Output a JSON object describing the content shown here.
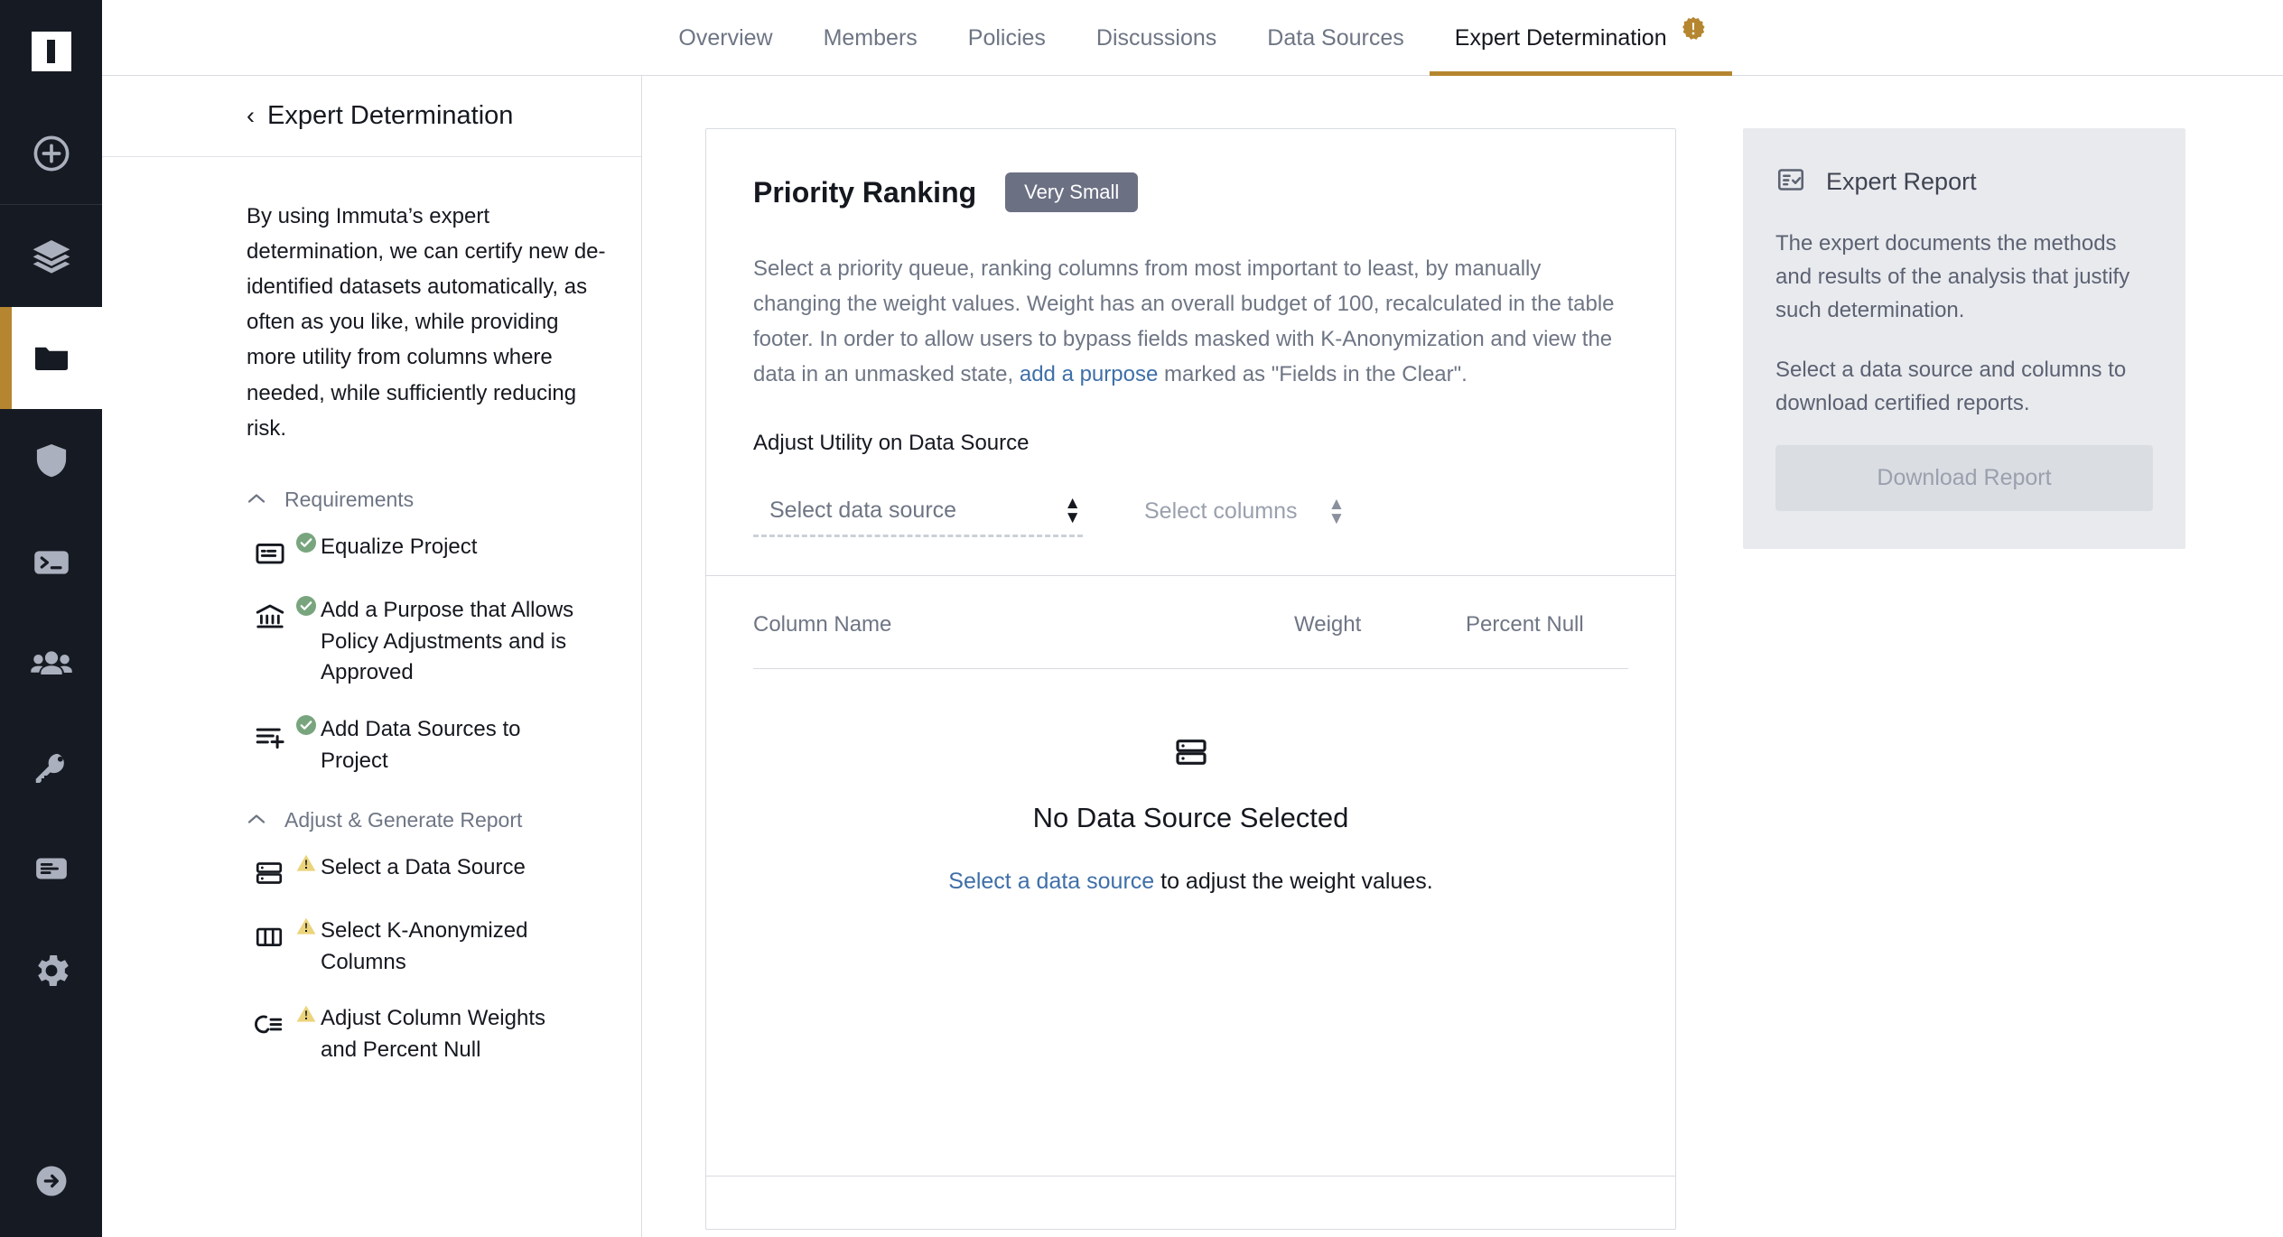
{
  "brand": {
    "logo_name": "immuta-logo",
    "accent_gold": "#B5862F",
    "rail_bg": "#161A22",
    "link_blue": "#3F6FA8",
    "badge_slate": "#6B7083"
  },
  "rail": {
    "items": [
      {
        "name": "add-icon",
        "label": "Add"
      },
      {
        "name": "layers-icon",
        "label": "Data"
      },
      {
        "name": "folder-icon",
        "label": "Projects",
        "active": true
      },
      {
        "name": "shield-icon",
        "label": "Governance"
      },
      {
        "name": "terminal-icon",
        "label": "Query"
      },
      {
        "name": "people-icon",
        "label": "People"
      },
      {
        "name": "key-icon",
        "label": "Identity"
      },
      {
        "name": "audit-icon",
        "label": "Audit"
      },
      {
        "name": "gear-icon",
        "label": "Settings"
      }
    ],
    "bottom": {
      "name": "collapse-arrow-icon",
      "label": "Expand"
    }
  },
  "tabs": [
    {
      "label": "Overview",
      "active": false,
      "badge": false
    },
    {
      "label": "Members",
      "active": false,
      "badge": false
    },
    {
      "label": "Policies",
      "active": false,
      "badge": false
    },
    {
      "label": "Discussions",
      "active": false,
      "badge": false
    },
    {
      "label": "Data Sources",
      "active": false,
      "badge": false
    },
    {
      "label": "Expert Determination",
      "active": true,
      "badge": true
    }
  ],
  "panel": {
    "back_chevron": "‹",
    "title": "Expert Determination",
    "intro": "By using Immuta’s expert determination, we can certify new de-identified datasets automatically, as often as you like, while providing more utility from columns where needed, while sufficiently reducing risk.",
    "groups": [
      {
        "title": "Requirements",
        "caret": "⌃",
        "expanded": true,
        "items": [
          {
            "label": "Equalize Project",
            "icon": "equalize-project-icon",
            "status": "complete"
          },
          {
            "label": "Add a Purpose that Allows Policy Adjustments and is Approved",
            "icon": "purpose-bank-icon",
            "status": "complete"
          },
          {
            "label": "Add Data Sources to Project",
            "icon": "add-data-source-icon",
            "status": "complete"
          }
        ]
      },
      {
        "title": "Adjust & Generate Report",
        "caret": "⌃",
        "expanded": true,
        "items": [
          {
            "label": "Select a Data Source",
            "icon": "server-select-icon",
            "status": "warning"
          },
          {
            "label": "Select K-Anonymized Columns",
            "icon": "columns-chart-icon",
            "status": "warning"
          },
          {
            "label": "Adjust Column Weights and Percent Null",
            "icon": "adjust-weights-icon",
            "status": "warning"
          }
        ]
      }
    ]
  },
  "card": {
    "title": "Priority Ranking",
    "size_badge": "Very Small",
    "description_part1": "Select a priority queue, ranking columns from most important to least, by manually changing the weight values. Weight has an overall budget of 100, recalculated in the table footer. In order to allow users to bypass fields masked with K-Anonymization and view the data in an unmasked state, ",
    "description_link": "add a purpose",
    "description_part2": " marked as \"Fields in the Clear\".",
    "section_label": "Adjust Utility on Data Source",
    "data_source_select": {
      "value": "Select data source",
      "placeholder": "Select data source"
    },
    "columns_select": {
      "value": "Select columns",
      "placeholder": "Select columns"
    },
    "table": {
      "headers": [
        "Column Name",
        "Weight",
        "Percent Null"
      ],
      "rows": []
    },
    "empty_state": {
      "icon": "server-icon",
      "title": "No Data Source Selected",
      "link_text": "Select a data source",
      "sub_text": " to adjust the weight values."
    }
  },
  "aside": {
    "icon": "report-checklist-icon",
    "title": "Expert Report",
    "paragraph1": "The expert documents the methods and results of the analysis that justify such determination.",
    "paragraph2": "Select a data source and columns to download certified reports.",
    "download_label": "Download Report",
    "download_disabled": true
  }
}
